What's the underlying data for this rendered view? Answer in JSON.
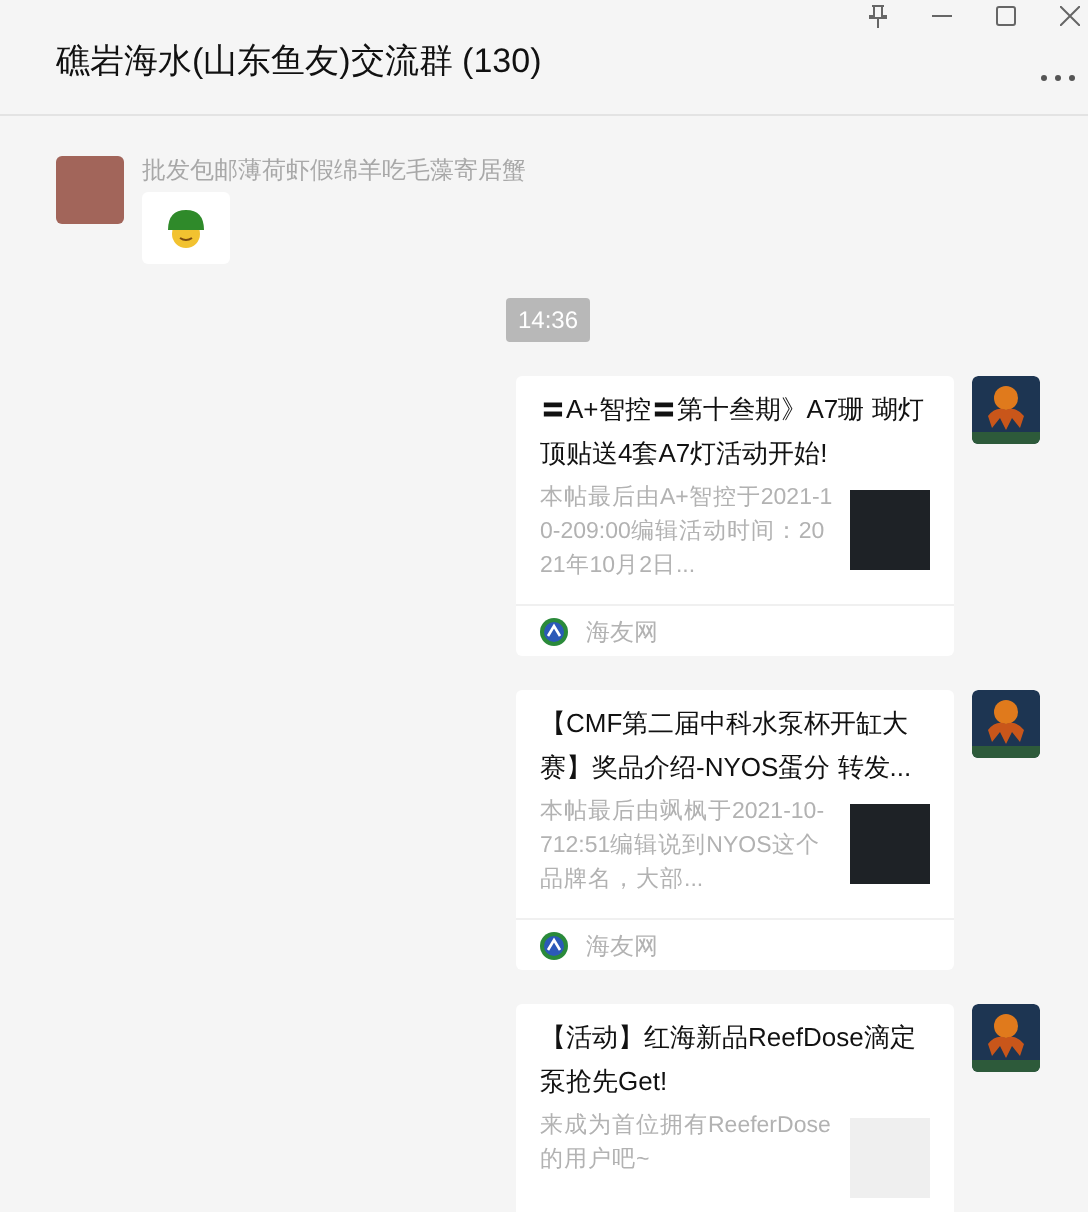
{
  "window": {
    "title": "礁岩海水(山东鱼友)交流群 (130)"
  },
  "messages": [
    {
      "kind": "emoji",
      "sender": "批发包邮薄荷虾假绵羊吃毛藻寄居蟹"
    },
    {
      "kind": "time",
      "text": "14:36"
    },
    {
      "kind": "link",
      "title": "〓A+智控〓第十叁期》A7珊 瑚灯顶贴送4套A7灯活动开始!",
      "description": "本帖最后由A+智控于2021-10-209:00编辑活动时间：2021年10月2日...",
      "image_loaded": true,
      "source": "海友网"
    },
    {
      "kind": "link",
      "title": "【CMF第二届中科水泵杯开缸大赛】奖品介绍-NYOS蛋分 转发...",
      "description": "本帖最后由飒枫于2021-10-712:51编辑说到NYOS这个品牌名，大部...",
      "image_loaded": true,
      "source": "海友网"
    },
    {
      "kind": "link",
      "title": "【活动】红海新品ReefDose滴定泵抢先Get!",
      "description": "来成为首位拥有ReeferDose的用户吧~",
      "image_loaded": false
    }
  ]
}
